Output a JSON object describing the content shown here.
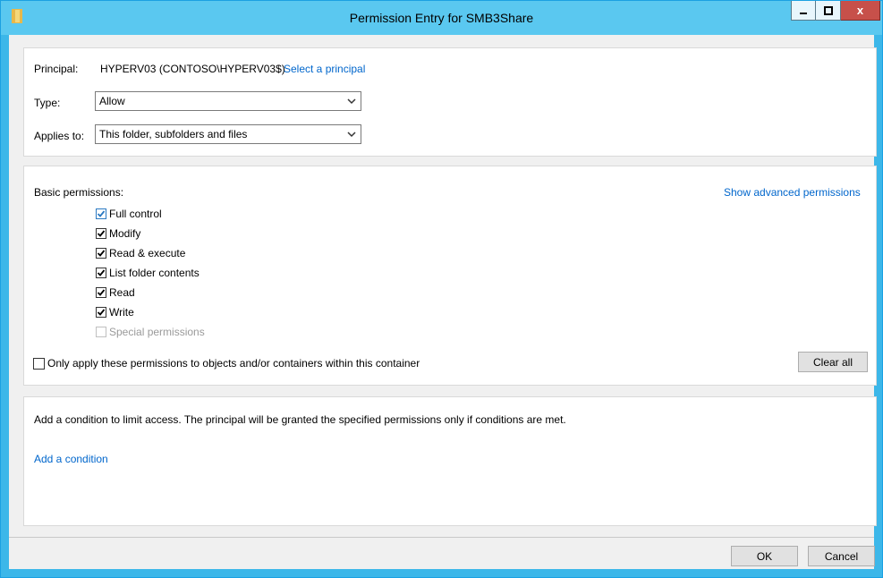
{
  "window": {
    "title": "Permission Entry for SMB3Share",
    "close_glyph": "x"
  },
  "principal": {
    "label": "Principal:",
    "value": "HYPERV03 (CONTOSO\\HYPERV03$)",
    "select_link": "Select a principal"
  },
  "type": {
    "label": "Type:",
    "value": "Allow"
  },
  "applies_to": {
    "label": "Applies to:",
    "value": "This folder, subfolders and files"
  },
  "permissions": {
    "heading": "Basic permissions:",
    "advanced_link": "Show advanced permissions",
    "items": [
      {
        "label": "Full control",
        "checked": true
      },
      {
        "label": "Modify",
        "checked": true
      },
      {
        "label": "Read & execute",
        "checked": true
      },
      {
        "label": "List folder contents",
        "checked": true
      },
      {
        "label": "Read",
        "checked": true
      },
      {
        "label": "Write",
        "checked": true
      },
      {
        "label": "Special permissions",
        "checked": false,
        "disabled": true
      }
    ],
    "only_apply_label": "Only apply these permissions to objects and/or containers within this container",
    "only_apply_checked": false,
    "clear_all": "Clear all"
  },
  "condition": {
    "description": "Add a condition to limit access. The principal will be granted the specified permissions only if conditions are met.",
    "add_link": "Add a condition"
  },
  "footer": {
    "ok": "OK",
    "cancel": "Cancel"
  },
  "colors": {
    "titlebar": "#5ac8f0",
    "link": "#0066cc",
    "close_button": "#c7504a"
  },
  "icons": {
    "app": "folder-icon",
    "minimize": "minimize-icon",
    "maximize": "maximize-icon",
    "close": "close-icon",
    "dropdown": "chevron-down-icon",
    "check": "checkmark-icon"
  }
}
